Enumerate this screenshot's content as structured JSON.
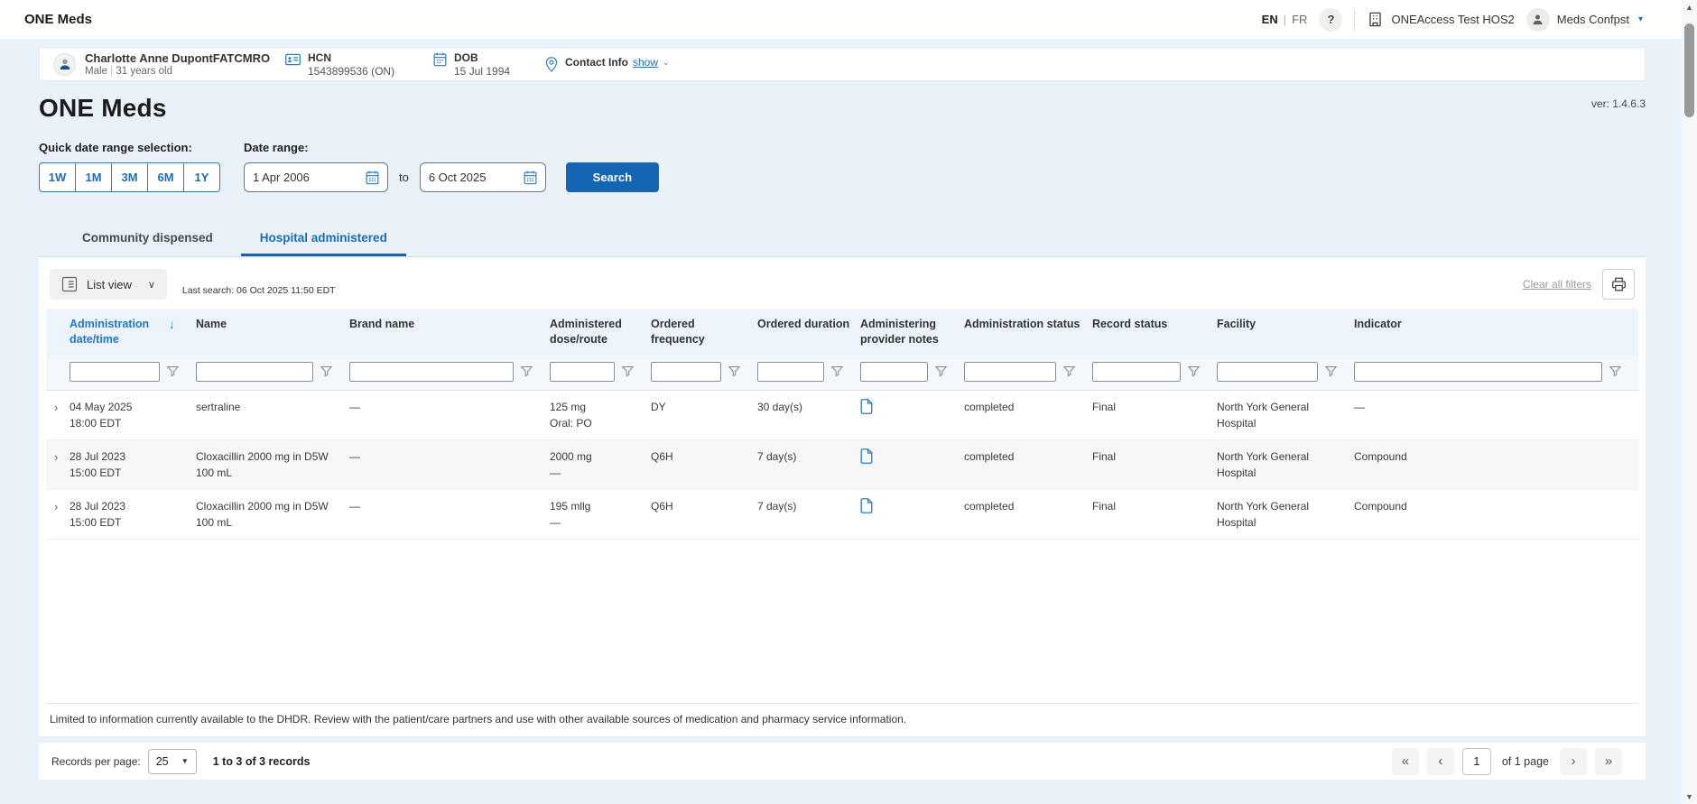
{
  "app": {
    "title": "ONE Meds",
    "version": "ver: 1.4.6.3"
  },
  "colors": {
    "accent_blue": "#1a73be",
    "button_blue": "#1565b5",
    "page_bg": "#e9f1f9",
    "header_row_bg": "#edf4fb"
  },
  "topbar": {
    "lang_en": "EN",
    "lang_sep": "|",
    "lang_fr": "FR",
    "help": "?",
    "org_name": "ONEAccess Test HOS2",
    "user_name": "Meds Confpst",
    "user_caret": "▾"
  },
  "patient": {
    "name": "Charlotte Anne DupontFATCMRO",
    "sex": "Male",
    "pipe": "|",
    "age": "31 years old",
    "hcn_label": "HCN",
    "hcn_value": "1543899536 (ON)",
    "dob_label": "DOB",
    "dob_value": "15 Jul 1994",
    "contact_label": "Contact Info",
    "contact_action": "show"
  },
  "search": {
    "quick_label": "Quick date range selection:",
    "quick_options": {
      "0": "1W",
      "1": "1M",
      "2": "3M",
      "3": "6M",
      "4": "1Y"
    },
    "range_label": "Date range:",
    "from_value": "1 Apr 2006",
    "to_word": "to",
    "to_value": "6 Oct 2025",
    "search_label": "Search"
  },
  "tabs": {
    "community": "Community dispensed",
    "hospital": "Hospital administered"
  },
  "toolbar": {
    "view_label": "List view",
    "last_search": "Last search: 06 Oct 2025 11:50 EDT",
    "clear_filters": "Clear all filters"
  },
  "table": {
    "columns": {
      "date": "Administration date/time",
      "name": "Name",
      "brand": "Brand name",
      "dose": "Administered dose/route",
      "freq": "Ordered frequency",
      "dur": "Ordered duration",
      "notes": "Administering provider notes",
      "astat": "Administration status",
      "rstat": "Record status",
      "fac": "Facility",
      "ind": "Indicator"
    },
    "sort_arrow": "↓",
    "rows": {
      "0": {
        "date1": "04 May 2025",
        "date2": "18:00 EDT",
        "name1": "sertraline",
        "name2": "",
        "brand": "—",
        "dose1": "125 mg",
        "dose2": "Oral: PO",
        "freq": "DY",
        "dur": "30 day(s)",
        "astat": "completed",
        "rstat": "Final",
        "fac1": "North York General",
        "fac2": "Hospital",
        "ind": "—"
      },
      "1": {
        "date1": "28 Jul 2023",
        "date2": "15:00 EDT",
        "name1": "Cloxacillin 2000 mg in D5W",
        "name2": "100 mL",
        "brand": "—",
        "dose1": "2000 mg",
        "dose2": "—",
        "freq": "Q6H",
        "dur": "7 day(s)",
        "astat": "completed",
        "rstat": "Final",
        "fac1": "North York General",
        "fac2": "Hospital",
        "ind": "Compound"
      },
      "2": {
        "date1": "28 Jul 2023",
        "date2": "15:00 EDT",
        "name1": "Cloxacillin 2000 mg in D5W",
        "name2": "100 mL",
        "brand": "—",
        "dose1": "195 mllg",
        "dose2": "—",
        "freq": "Q6H",
        "dur": "7 day(s)",
        "astat": "completed",
        "rstat": "Final",
        "fac1": "North York General",
        "fac2": "Hospital",
        "ind": "Compound"
      }
    },
    "expander_glyph": "›"
  },
  "footer": {
    "disclaimer": "Limited to information currently available to the DHDR. Review with the patient/care partners and use with other available sources of medication and pharmacy service information.",
    "records_label": "Records per page:",
    "records_value": "25",
    "range_text": "1 to 3 of 3 records",
    "pg_first": "«",
    "pg_prev": "‹",
    "page": "1",
    "page_suffix": "of 1 page",
    "pg_next": "›",
    "pg_last": "»"
  }
}
